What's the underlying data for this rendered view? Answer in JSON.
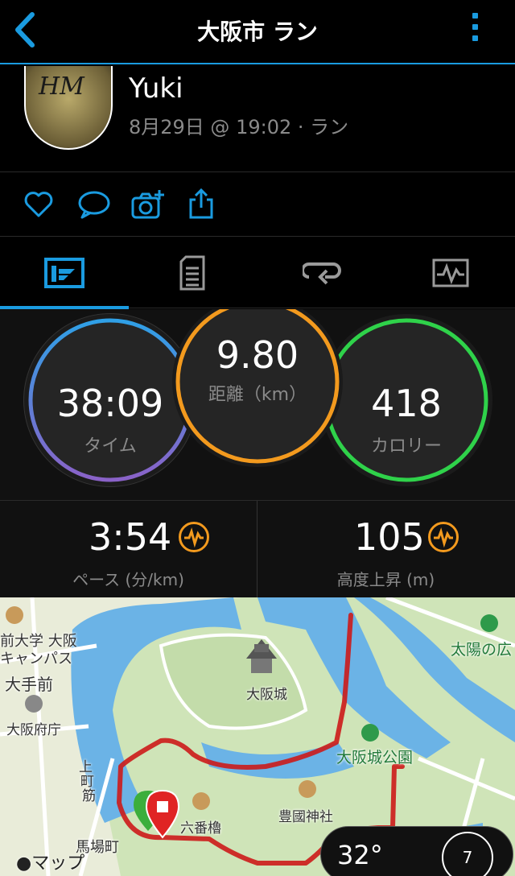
{
  "header": {
    "title": "大阪市 ラン",
    "back_icon": "chevron-left-icon",
    "more_icon": "vertical-dots-icon",
    "accent_color": "#1a9be0"
  },
  "profile": {
    "name": "Yuki",
    "meta": "8月29日 @ 19:02 · ラン",
    "avatar_text": "HM"
  },
  "actions": {
    "icons": [
      "heart-icon",
      "comment-icon",
      "camera-add-icon",
      "share-icon"
    ]
  },
  "tabs": {
    "items": [
      "summary-icon",
      "details-icon",
      "laps-icon",
      "charts-icon"
    ],
    "active_index": 0
  },
  "stats": {
    "time": {
      "value": "38:09",
      "label": "タイム",
      "color": "#8a62c8"
    },
    "distance": {
      "value": "9.80",
      "label": "距離（km）",
      "color": "#f39a1e"
    },
    "calories": {
      "value": "418",
      "label": "カロリー",
      "color": "#2fd24a"
    }
  },
  "metrics": {
    "pace": {
      "value": "3:54",
      "label": "ペース (分/km)"
    },
    "elevation": {
      "value": "105",
      "label": "高度上昇 (m)"
    }
  },
  "map": {
    "labels": {
      "univ": "前大学 大阪",
      "campus": "キャンパス",
      "otemae": "大手前",
      "prefoffice": "大阪府庁",
      "kamimachi1": "上",
      "kamimachi2": "町",
      "kamimachi3": "筋",
      "castle": "大阪城",
      "park": "大阪城公園",
      "shrine": "豊國神社",
      "rokuban": "六番櫓",
      "banba": "馬場町",
      "taiyo": "太陽の広"
    },
    "attribution": "マップ",
    "weather": {
      "temp": "32°",
      "wind": "7"
    }
  }
}
